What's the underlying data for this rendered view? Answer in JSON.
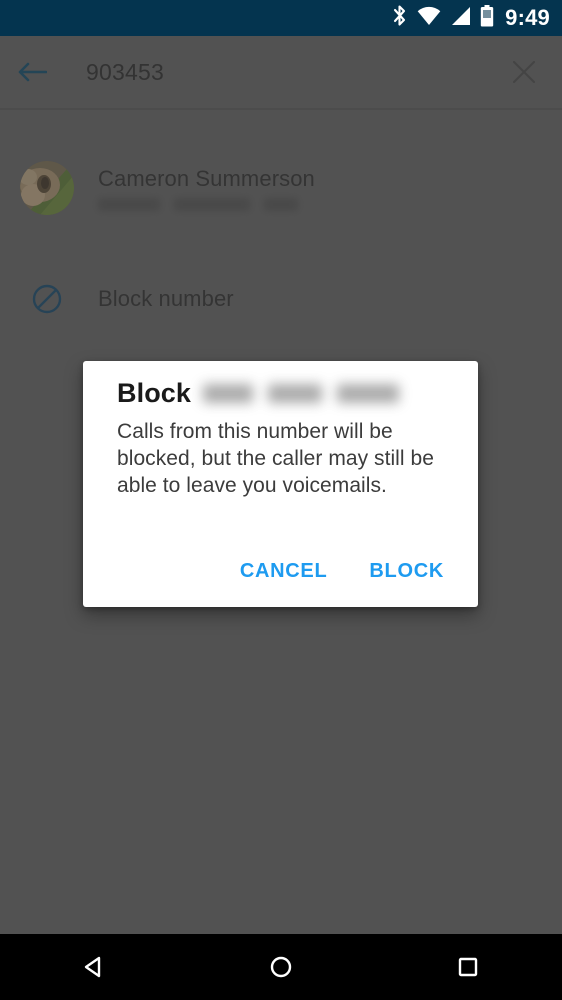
{
  "status_bar": {
    "time": "9:49",
    "icons": [
      "bluetooth-icon",
      "wifi-icon",
      "cellular-signal-icon",
      "battery-icon"
    ],
    "background_color": "#04344f",
    "foreground_color": "#ffffff"
  },
  "toolbar": {
    "back_icon": "back-arrow-icon",
    "title": "903453",
    "close_icon": "close-x-icon",
    "back_icon_color": "#0f4c6b",
    "title_color": "#2b2b2b"
  },
  "contact": {
    "avatar_icon": "contact-photo-avatar",
    "name": "Cameron Summerson",
    "subtitle_redacted": true
  },
  "block_row": {
    "icon": "block-circle-slash-icon",
    "icon_color": "#0f4c6b",
    "label": "Block number"
  },
  "dialog": {
    "title_prefix": "Block",
    "title_number_redacted": true,
    "message": "Calls from this number will be blocked, but the caller may still be able to leave you voicemails.",
    "cancel_label": "CANCEL",
    "confirm_label": "BLOCK",
    "button_color": "#1e9bf0",
    "background_color": "#ffffff"
  },
  "nav_bar": {
    "back_icon": "nav-back-triangle-icon",
    "home_icon": "nav-home-circle-icon",
    "recents_icon": "nav-recents-square-icon",
    "background_color": "#000000"
  },
  "screen": {
    "scrim_color": "#616161"
  }
}
